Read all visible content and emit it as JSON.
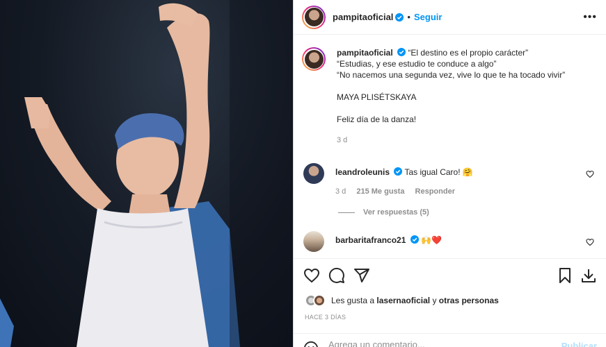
{
  "post": {
    "username": "pampitaoficial",
    "follow_label": "Seguir",
    "separator": "•"
  },
  "caption": {
    "username": "pampitaoficial",
    "line1": "“El destino es el propio carácter”",
    "line2": "“Estudias, y ese estudio te conduce a algo”",
    "line3": "“No nacemos una segunda vez, vive lo que te ha tocado vivir”",
    "line4": "MAYA PLISÉTSKAYA",
    "line5": "Feliz día de la danza!",
    "age": "3 d"
  },
  "comments": [
    {
      "username": "leandroleunis",
      "text": "Tas igual Caro! 🤗",
      "age": "3 d",
      "likes": "215 Me gusta",
      "reply_label": "Responder",
      "view_replies": "Ver respuestas (5)"
    },
    {
      "username": "barbaritafranco21",
      "text": "🙌❤️"
    }
  ],
  "likes": {
    "prefix": "Les gusta a ",
    "user": "lasernaoficial",
    "middle": " y ",
    "others": "otras personas"
  },
  "timestamp": "HACE 3 DÍAS",
  "add_comment": {
    "placeholder": "Agrega un comentario...",
    "publish_label": "Publicar"
  },
  "colors": {
    "accent": "#0095f6",
    "verified": "#0095f6",
    "heart": "#ed4956"
  },
  "icons": [
    "more-icon",
    "heart-icon",
    "comment-icon",
    "share-icon",
    "save-icon",
    "download-icon",
    "emoji-icon",
    "verified-badge-icon"
  ]
}
